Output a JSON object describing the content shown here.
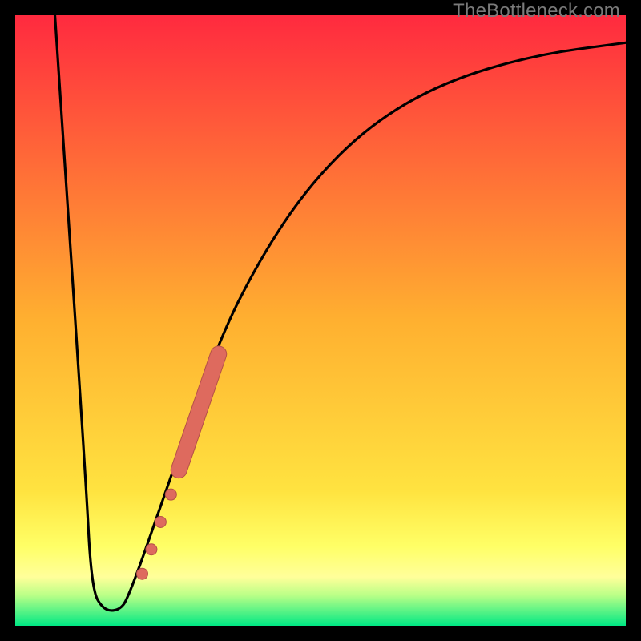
{
  "watermark": "TheBottleneck.com",
  "colors": {
    "top": "#ff2a3f",
    "mid": "#ffcf3d",
    "yellow_band": "#ffff66",
    "green_start": "#c8ff8a",
    "green_end": "#00e884",
    "curve": "#000000",
    "marker": "#de6a5e",
    "marker_stroke": "#b55047"
  },
  "chart_data": {
    "type": "line",
    "title": "",
    "xlabel": "",
    "ylabel": "",
    "xlim": [
      0,
      100
    ],
    "ylim": [
      0,
      100
    ],
    "curve": [
      {
        "x": 6.5,
        "y": 100
      },
      {
        "x": 11.5,
        "y": 25
      },
      {
        "x": 12.5,
        "y": 6
      },
      {
        "x": 14.5,
        "y": 2.5
      },
      {
        "x": 17.0,
        "y": 2.5
      },
      {
        "x": 18.5,
        "y": 4.5
      },
      {
        "x": 24.0,
        "y": 20
      },
      {
        "x": 33.0,
        "y": 46
      },
      {
        "x": 40.0,
        "y": 60
      },
      {
        "x": 48.0,
        "y": 72
      },
      {
        "x": 58.0,
        "y": 82
      },
      {
        "x": 70.0,
        "y": 89
      },
      {
        "x": 85.0,
        "y": 93.5
      },
      {
        "x": 100.0,
        "y": 95.5
      }
    ],
    "markers": [
      {
        "x": 20.8,
        "y": 8.5,
        "r": 7
      },
      {
        "x": 22.3,
        "y": 12.5,
        "r": 7
      },
      {
        "x": 23.8,
        "y": 17.0,
        "r": 7
      },
      {
        "x": 25.5,
        "y": 21.5,
        "r": 7
      }
    ],
    "marker_bar": {
      "x1": 26.8,
      "y1": 25.5,
      "x2": 33.3,
      "y2": 44.5,
      "width": 19
    }
  }
}
